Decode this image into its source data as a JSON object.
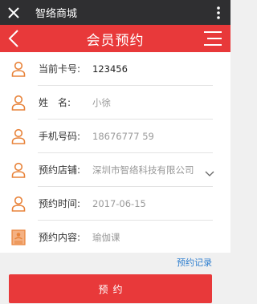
{
  "browser": {
    "title": "智络商城"
  },
  "header": {
    "title": "会员预约"
  },
  "form": {
    "rows": [
      {
        "label": "当前卡号:",
        "value": "123456",
        "icon": "person-icon"
      },
      {
        "label": "姓　名:",
        "value": "小徐",
        "icon": "person-icon"
      },
      {
        "label": "手机号码:",
        "value": "18676777 59",
        "icon": "person-icon"
      },
      {
        "label": "预约店铺:",
        "value": "深圳市智络科技有限公司",
        "icon": "person-icon"
      },
      {
        "label": "预约时间:",
        "value": "2017-06-15",
        "icon": "person-icon"
      },
      {
        "label": "预约内容:",
        "value": "瑜伽课",
        "icon": "document-icon"
      }
    ]
  },
  "links": {
    "record": "预约记录"
  },
  "submit": {
    "label": "预约"
  },
  "colors": {
    "accent": "#e8393a",
    "icon": "#e8833a",
    "link": "#2f7fcf"
  }
}
